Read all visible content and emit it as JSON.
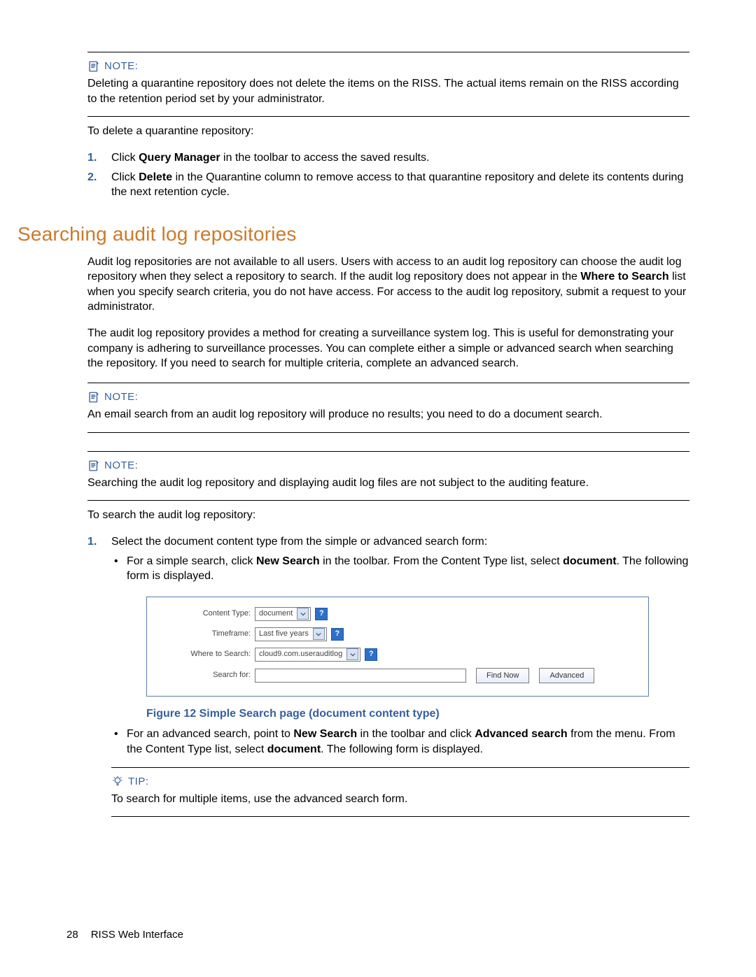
{
  "callouts": {
    "note1": {
      "label": "NOTE:",
      "body": "Deleting a quarantine repository does not delete the items on the RISS. The actual items remain on the RISS according to the retention period set by your administrator."
    },
    "note2": {
      "label": "NOTE:",
      "body": "An email search from an audit log repository will produce no results; you need to do a document search."
    },
    "note3": {
      "label": "NOTE:",
      "body": "Searching the audit log repository and displaying audit log files are not subject to the auditing feature."
    },
    "tip1": {
      "label": "TIP:",
      "body": "To search for multiple items, use the advanced search form."
    }
  },
  "delete_proc": {
    "intro": "To delete a quarantine repository:",
    "step1_a": "Click ",
    "step1_b": "Query Manager",
    "step1_c": " in the toolbar to access the saved results.",
    "step2_a": "Click ",
    "step2_b": "Delete",
    "step2_c": " in the Quarantine column to remove access to that quarantine repository and delete its contents during the next retention cycle."
  },
  "section_heading": "Searching audit log repositories",
  "audit_para1_a": "Audit log repositories are not available to all users. Users with access to an audit log repository can choose the audit log repository when they select a repository to search. If the audit log repository does not appear in the ",
  "audit_para1_b": "Where to Search",
  "audit_para1_c": " list when you specify search criteria, you do not have access. For access to the audit log repository, submit a request to your administrator.",
  "audit_para2": "The audit log repository provides a method for creating a surveillance system log. This is useful for demonstrating your company is adhering to surveillance processes. You can complete either a simple or advanced search when searching the repository. If you need to search for multiple criteria, complete an advanced search.",
  "search_proc": {
    "intro": "To search the audit log repository:",
    "step1": "Select the document content type from the simple or advanced search form:",
    "bullet1_a": "For a simple search, click ",
    "bullet1_b": "New Search",
    "bullet1_c": " in the toolbar. From the Content Type list, select ",
    "bullet1_d": "document",
    "bullet1_e": ". The following form is displayed.",
    "bullet2_a": "For an advanced search, point to ",
    "bullet2_b": "New Search",
    "bullet2_c": " in the toolbar and click ",
    "bullet2_d": "Advanced search",
    "bullet2_e": " from the menu. From the Content Type list, select ",
    "bullet2_f": "document",
    "bullet2_g": ". The following form is displayed."
  },
  "figure": {
    "caption": "Figure 12 Simple Search page (document content type)",
    "labels": {
      "content_type": "Content Type:",
      "timeframe": "Timeframe:",
      "where": "Where to Search:",
      "search_for": "Search for:"
    },
    "values": {
      "content_type": "document",
      "timeframe": "Last five years",
      "where": "cloud9.com.userauditlog"
    },
    "help_glyph": "?",
    "buttons": {
      "find": "Find Now",
      "advanced": "Advanced"
    }
  },
  "footer": {
    "page": "28",
    "title": "RISS Web Interface"
  }
}
